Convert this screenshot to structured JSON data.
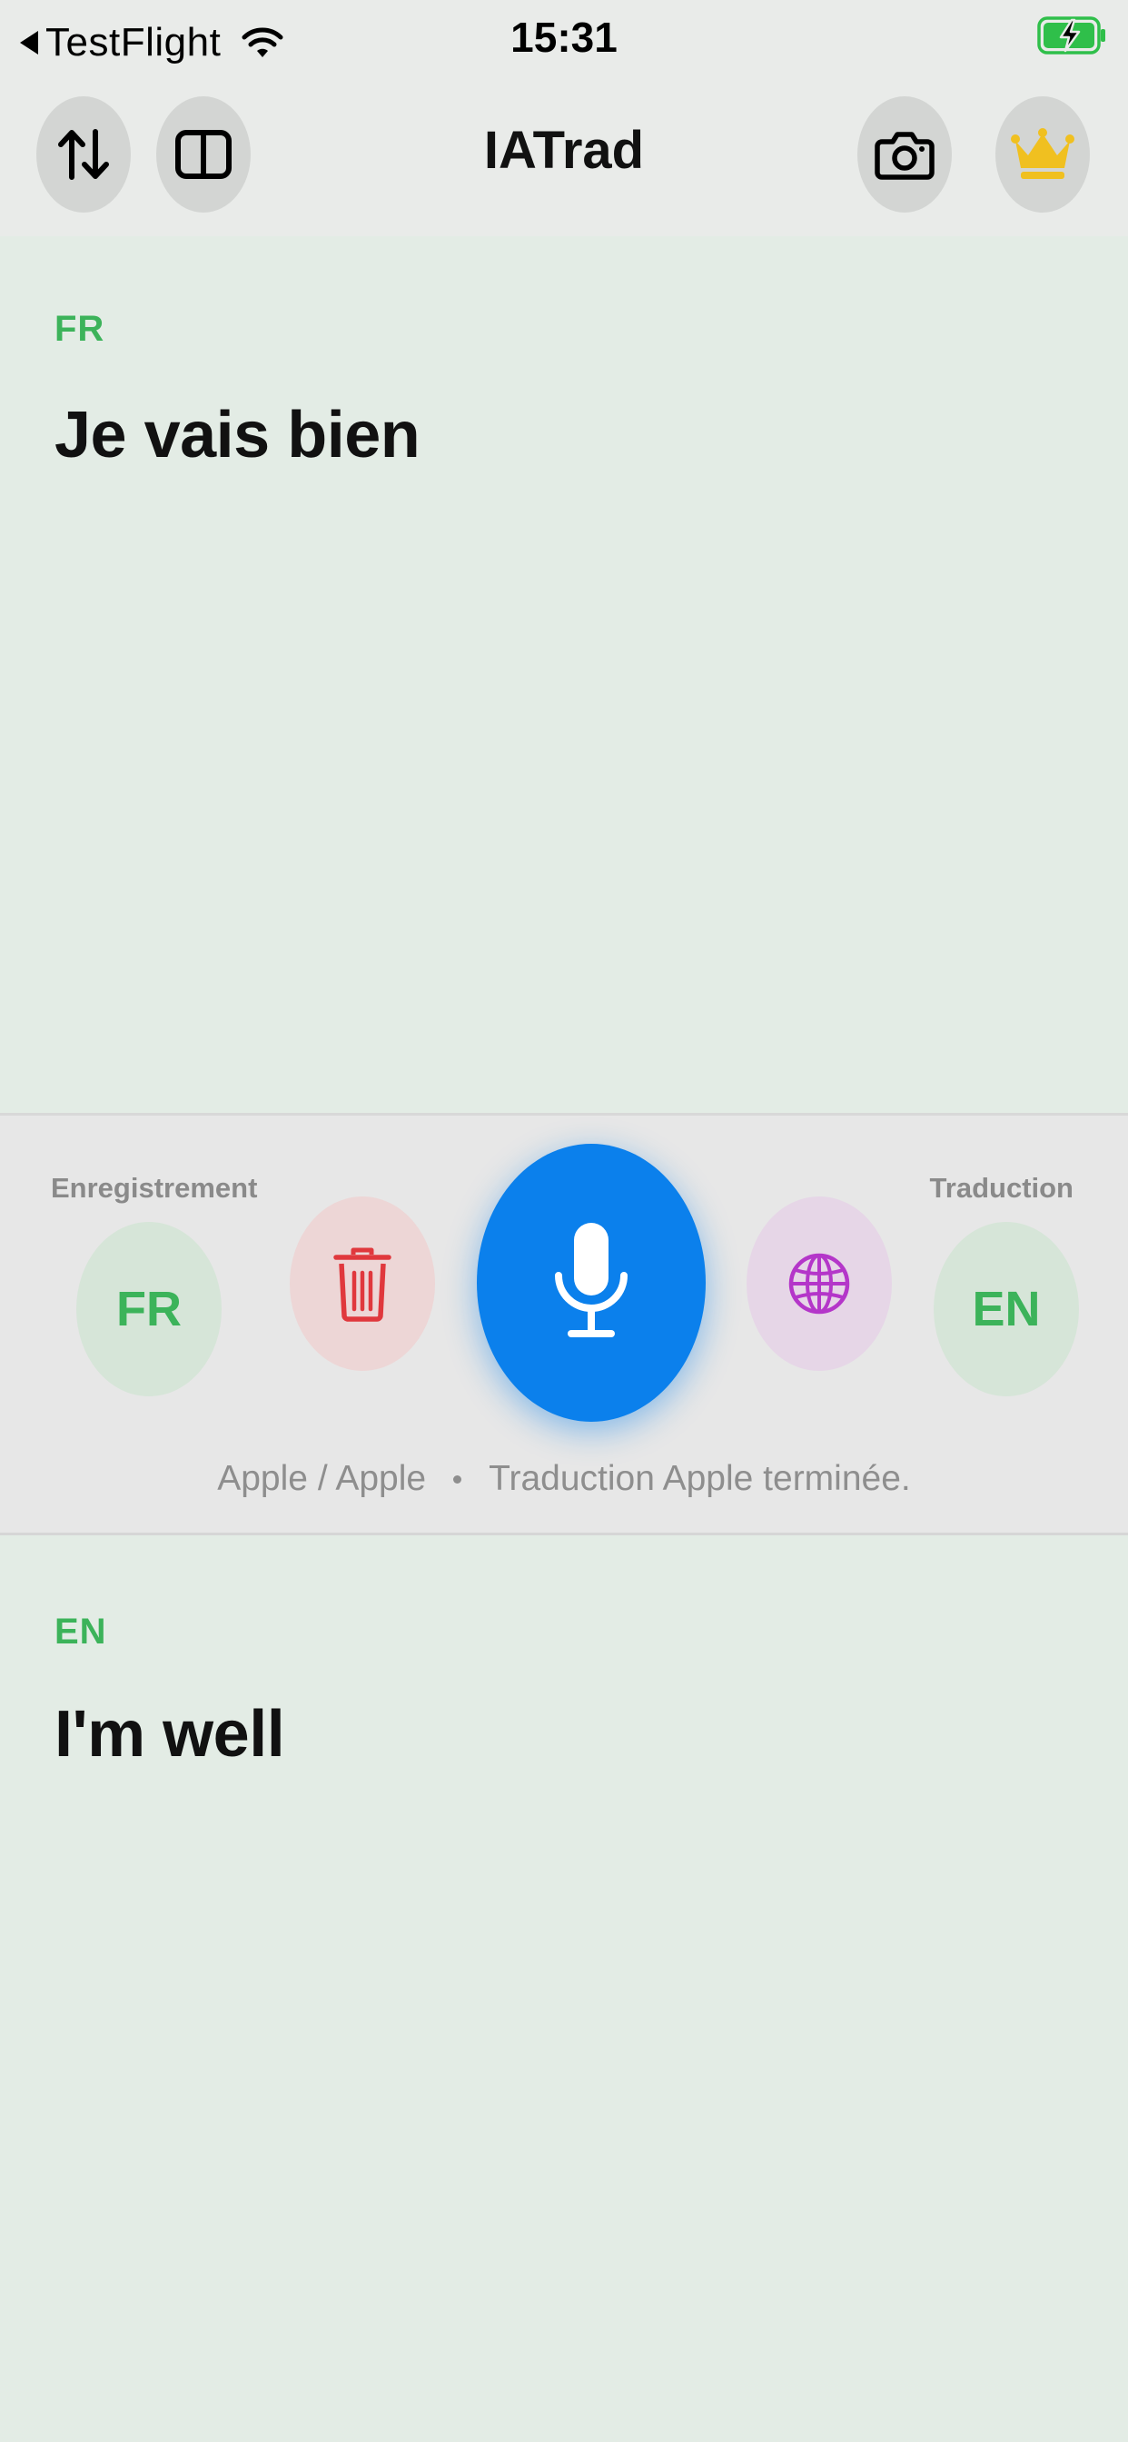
{
  "status_bar": {
    "back_label": "TestFlight",
    "time": "15:31"
  },
  "nav": {
    "title": "IATrad",
    "icons": {
      "swap": "swap-vertical-icon",
      "split": "split-view-icon",
      "camera": "camera-icon",
      "premium": "crown-icon"
    }
  },
  "source": {
    "lang": "FR",
    "text": "Je vais bien"
  },
  "target": {
    "lang": "EN",
    "text": "I'm well"
  },
  "controls": {
    "record_label": "Enregistrement",
    "translate_label": "Traduction",
    "source_lang_button": "FR",
    "target_lang_button": "EN",
    "status_engines": "Apple / Apple",
    "status_message": "Traduction Apple terminée."
  },
  "colors": {
    "accent_green": "#3cb35a",
    "mic_blue": "#0b80ec",
    "trash_red": "#e0383d",
    "globe_purple": "#b436c9",
    "crown_gold": "#f0c020",
    "background": "#e3ece5"
  }
}
